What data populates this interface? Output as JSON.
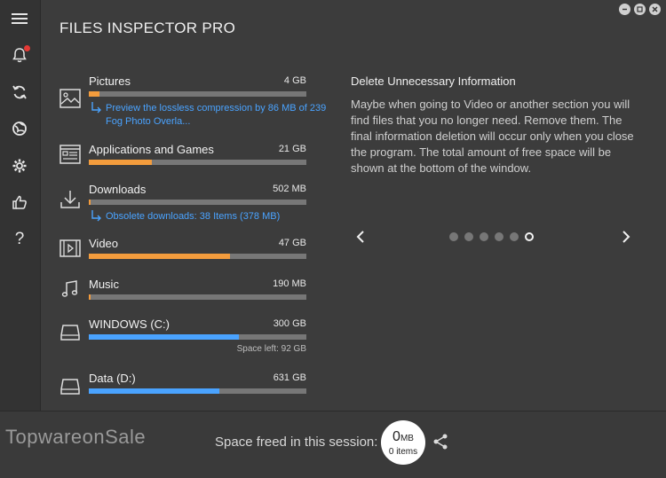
{
  "app": {
    "title": "FILES INSPECTOR PRO"
  },
  "sidebar": {
    "items": [
      {
        "icon": "menu-icon"
      },
      {
        "icon": "bell-icon",
        "badge": true
      },
      {
        "icon": "refresh-icon"
      },
      {
        "icon": "globe-icon"
      },
      {
        "icon": "gear-icon"
      },
      {
        "icon": "thumbs-up-icon"
      },
      {
        "icon": "help-icon",
        "label": "?"
      }
    ]
  },
  "categories": [
    {
      "name": "Pictures",
      "size": "4 GB",
      "progress": 0.05,
      "color": "#f39c3d",
      "icon": "image-icon",
      "hint": "Preview the lossless compression by 86 MB of 239 Fog Photo Overla..."
    },
    {
      "name": "Applications and Games",
      "size": "21 GB",
      "progress": 0.29,
      "color": "#f39c3d",
      "icon": "applications-icon"
    },
    {
      "name": "Downloads",
      "size": "502 MB",
      "progress": 0.01,
      "color": "#f39c3d",
      "icon": "download-icon",
      "hint": "Obsolete downloads: 38 Items (378 MB)"
    },
    {
      "name": "Video",
      "size": "47 GB",
      "progress": 0.65,
      "color": "#f39c3d",
      "icon": "video-icon"
    },
    {
      "name": "Music",
      "size": "190 MB",
      "progress": 0.01,
      "color": "#f39c3d",
      "icon": "music-icon"
    },
    {
      "name": "WINDOWS (C:)",
      "size": "300 GB",
      "progress": 0.69,
      "color": "#4aa3ff",
      "icon": "drive-icon",
      "space_left": "Space left: 92 GB"
    },
    {
      "name": "Data (D:)",
      "size": "631 GB",
      "progress": 0.6,
      "color": "#4aa3ff",
      "icon": "drive-icon"
    }
  ],
  "info": {
    "title": "Delete Unnecessary Information",
    "text": "Maybe when going to Video or another section you will find files that you no longer need. Remove them. The final information deletion will occur only when you close the program. The total amount of free space will be shown at the bottom of the window.",
    "page_count": 6,
    "active_page": 6
  },
  "footer": {
    "watermark": "TopwareonSale",
    "freed_label": "Space freed in this session:",
    "freed_value": "0",
    "freed_unit": "MB",
    "freed_items": "0 items"
  },
  "colors": {
    "accent_orange": "#f39c3d",
    "accent_blue": "#4aa3ff",
    "link": "#4aa3ff"
  }
}
